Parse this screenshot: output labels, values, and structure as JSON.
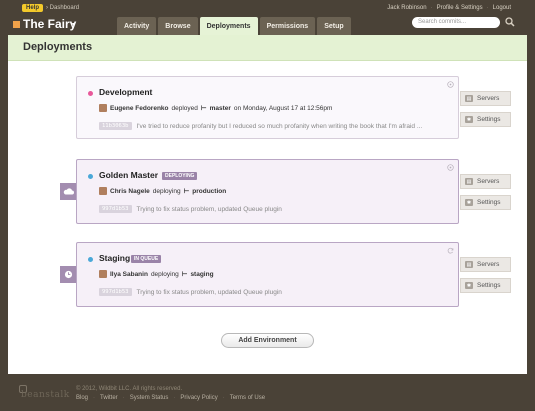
{
  "topbar": {
    "help_label": "Help",
    "breadcrumb_separator": "›",
    "breadcrumb_dashboard": "Dashboard",
    "app_name": "The Fairy",
    "app_caret": "▾",
    "tabs": [
      {
        "label": "Activity",
        "active": false
      },
      {
        "label": "Browse",
        "active": false
      },
      {
        "label": "Deployments",
        "active": true
      },
      {
        "label": "Permissions",
        "active": false
      },
      {
        "label": "Setup",
        "active": false
      }
    ],
    "user_name": "Jack Robinson",
    "profile_link": "Profile & Settings",
    "logout_link": "Logout",
    "link_separator": "·",
    "search_placeholder": "Search commits..."
  },
  "page": {
    "title": "Deployments"
  },
  "environments": [
    {
      "name": "Development",
      "dot_color": "#e8589a",
      "badge": "",
      "author": "Eugene Fedorenko",
      "action": "deployed",
      "branch": "master",
      "when": "on Monday, August 17 at 12:56pm",
      "revision": "11b3063b",
      "message": "I've tried to reduce profanity but I reduced so much profanity when writing the book that I'm afraid ...",
      "corner_icon": "status-icon"
    },
    {
      "name": "Golden Master",
      "dot_color": "#4aa8d8",
      "badge": "DEPLOYING",
      "author": "Chris Nagele",
      "action": "deploying",
      "branch": "production",
      "when": "",
      "revision": "997d1b53",
      "message": "Trying to fix status problem, updated Queue plugin",
      "corner_icon": "status-icon"
    },
    {
      "name": "Staging",
      "dot_color": "#4aa8d8",
      "badge": "IN QUEUE",
      "author": "Ilya Sabanin",
      "action": "deploying",
      "branch": "staging",
      "when": "",
      "revision": "997d1b53",
      "message": "Trying to fix status problem, updated Queue plugin",
      "corner_icon": "refresh-icon"
    }
  ],
  "side_buttons": {
    "servers_label": "Servers",
    "settings_label": "Settings"
  },
  "add_button": "Add Environment",
  "footer": {
    "logo_text": "beanstalk",
    "copyright": "© 2012, Wildbit LLC. All rights reserved.",
    "links": [
      "Blog",
      "Twitter",
      "System Status",
      "Privacy Policy",
      "Terms of Use"
    ],
    "link_separator": "·"
  },
  "colors": {
    "background": "#4a4237",
    "header_band": "#e4f2d3",
    "accent_purple": "#a38db0",
    "help_yellow": "#f3c92b",
    "brand_orange": "#f0a24a"
  }
}
